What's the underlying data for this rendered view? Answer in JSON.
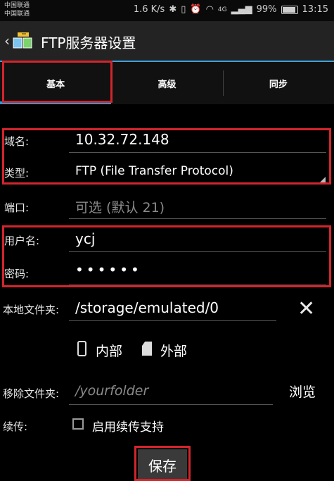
{
  "status_bar": {
    "carrier_1": "中国联通",
    "carrier_2": "中国联通",
    "speed": "1.6 K/s",
    "network": "4G",
    "battery": "99%",
    "time": "13:15"
  },
  "app_bar": {
    "title": "FTP服务器设置"
  },
  "tabs": [
    {
      "label": "基本",
      "selected": true
    },
    {
      "label": "高级",
      "selected": false
    },
    {
      "label": "同步",
      "selected": false
    }
  ],
  "form": {
    "host_label": "域名:",
    "host_value": "10.32.72.148",
    "type_label": "类型:",
    "type_value": "FTP (File Transfer Protocol)",
    "port_label": "端口:",
    "port_placeholder": "可选 (默认 21)",
    "user_label": "用户名:",
    "user_value": "ycj",
    "password_label": "密码:",
    "password_value": "••••••",
    "local_folder_label": "本地文件夹:",
    "local_folder_value": "/storage/emulated/0",
    "internal_label": "内部",
    "external_label": "外部",
    "remote_folder_label": "移除文件夹:",
    "remote_folder_placeholder": "/yourfolder",
    "browse_label": "浏览",
    "resume_label": "续传:",
    "resume_checkbox_label": "启用续传支持",
    "resume_checked": false
  },
  "save_label": "保存",
  "colors": {
    "highlight": "#d3252c",
    "accent": "#2f9ad3",
    "background": "#000000"
  }
}
